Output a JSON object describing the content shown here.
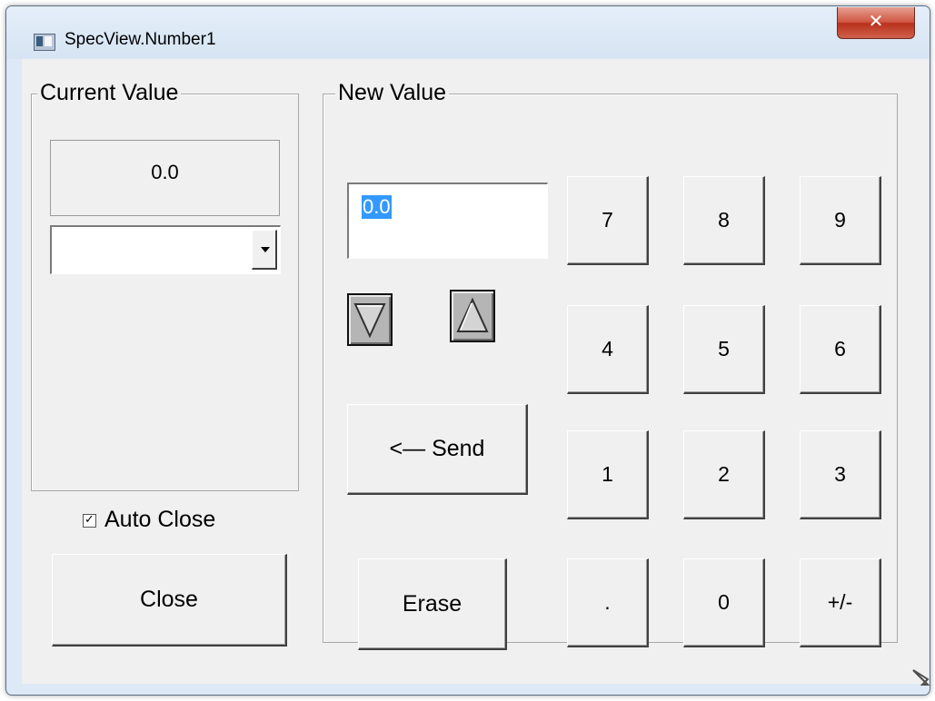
{
  "window": {
    "title": "SpecView.Number1",
    "close_glyph": "✕"
  },
  "current_value": {
    "label": "Current Value",
    "display": "0.0",
    "combo_value": ""
  },
  "auto_close": {
    "label": "Auto Close",
    "checked": true,
    "check_glyph": "✓"
  },
  "close_button": {
    "label": "Close"
  },
  "new_value": {
    "label": "New Value",
    "entry": "0.0",
    "decrement_icon": "triangle-down-icon",
    "increment_icon": "triangle-up-icon",
    "send_label": "<— Send",
    "erase_label": "Erase",
    "keys": [
      "7",
      "8",
      "9",
      "4",
      "5",
      "6",
      "1",
      "2",
      "3",
      ".",
      "0",
      "+/-"
    ]
  },
  "colors": {
    "selection": "#3399ff",
    "face": "#f0f0f0",
    "frame": "#dde9f6",
    "close": "#c9452f"
  }
}
